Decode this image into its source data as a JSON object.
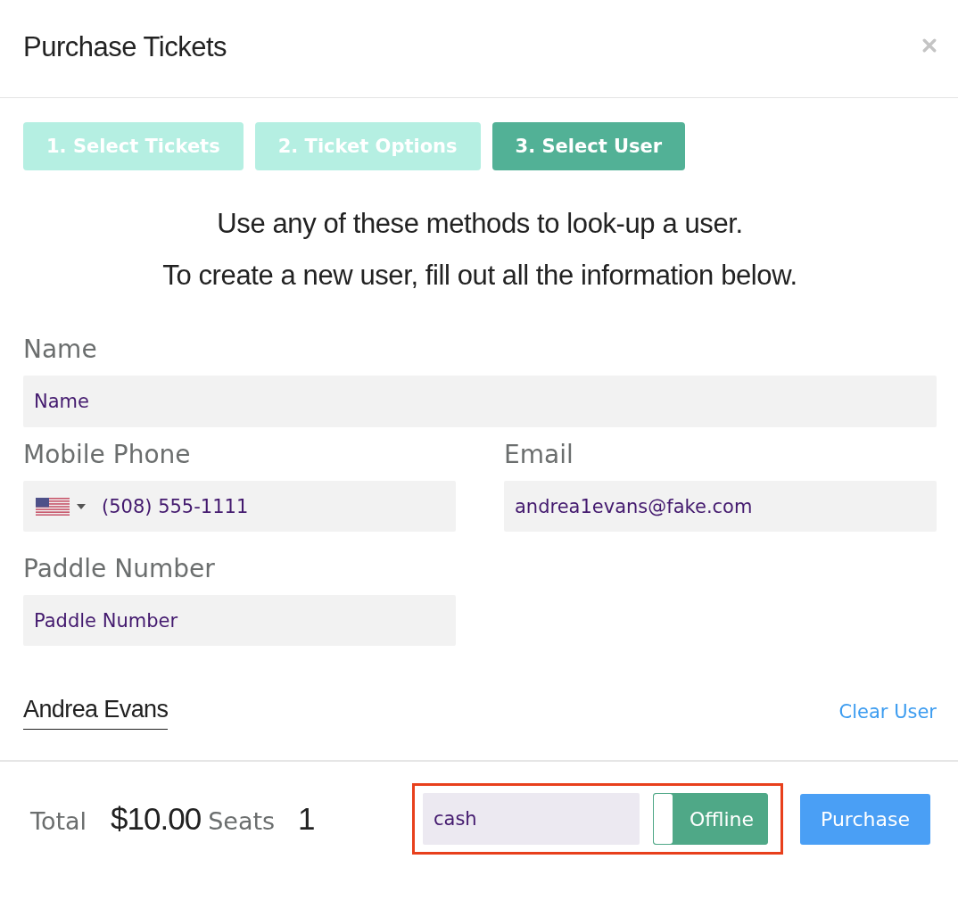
{
  "window": {
    "title": "Purchase Tickets"
  },
  "steps": [
    {
      "label": "1. Select Tickets",
      "selected": false
    },
    {
      "label": "2. Ticket Options",
      "selected": false
    },
    {
      "label": "3. Select User",
      "selected": true
    }
  ],
  "instructions": [
    "Use any of these methods to look-up a user.",
    "To create a new user, fill out all the information below."
  ],
  "form": {
    "name": {
      "label": "Name",
      "placeholder": "Name"
    },
    "mobile_phone": {
      "label": "Mobile Phone",
      "value": "(508) 555-1111"
    },
    "email": {
      "label": "Email",
      "value": "andrea1evans@fake.com"
    },
    "paddle_number": {
      "label": "Paddle Number",
      "placeholder": "Paddle Number"
    }
  },
  "selected_user": {
    "name": "Andrea Evans",
    "clear_link": "Clear User"
  },
  "footer": {
    "total_label": "Total",
    "total": "$10.00",
    "seats_label": "Seats",
    "seats": "1",
    "payment": {
      "highlighted": true,
      "method": "cash",
      "toggle": {
        "label": "Offline",
        "on": true
      }
    },
    "purchase_button": "Purchase"
  }
}
